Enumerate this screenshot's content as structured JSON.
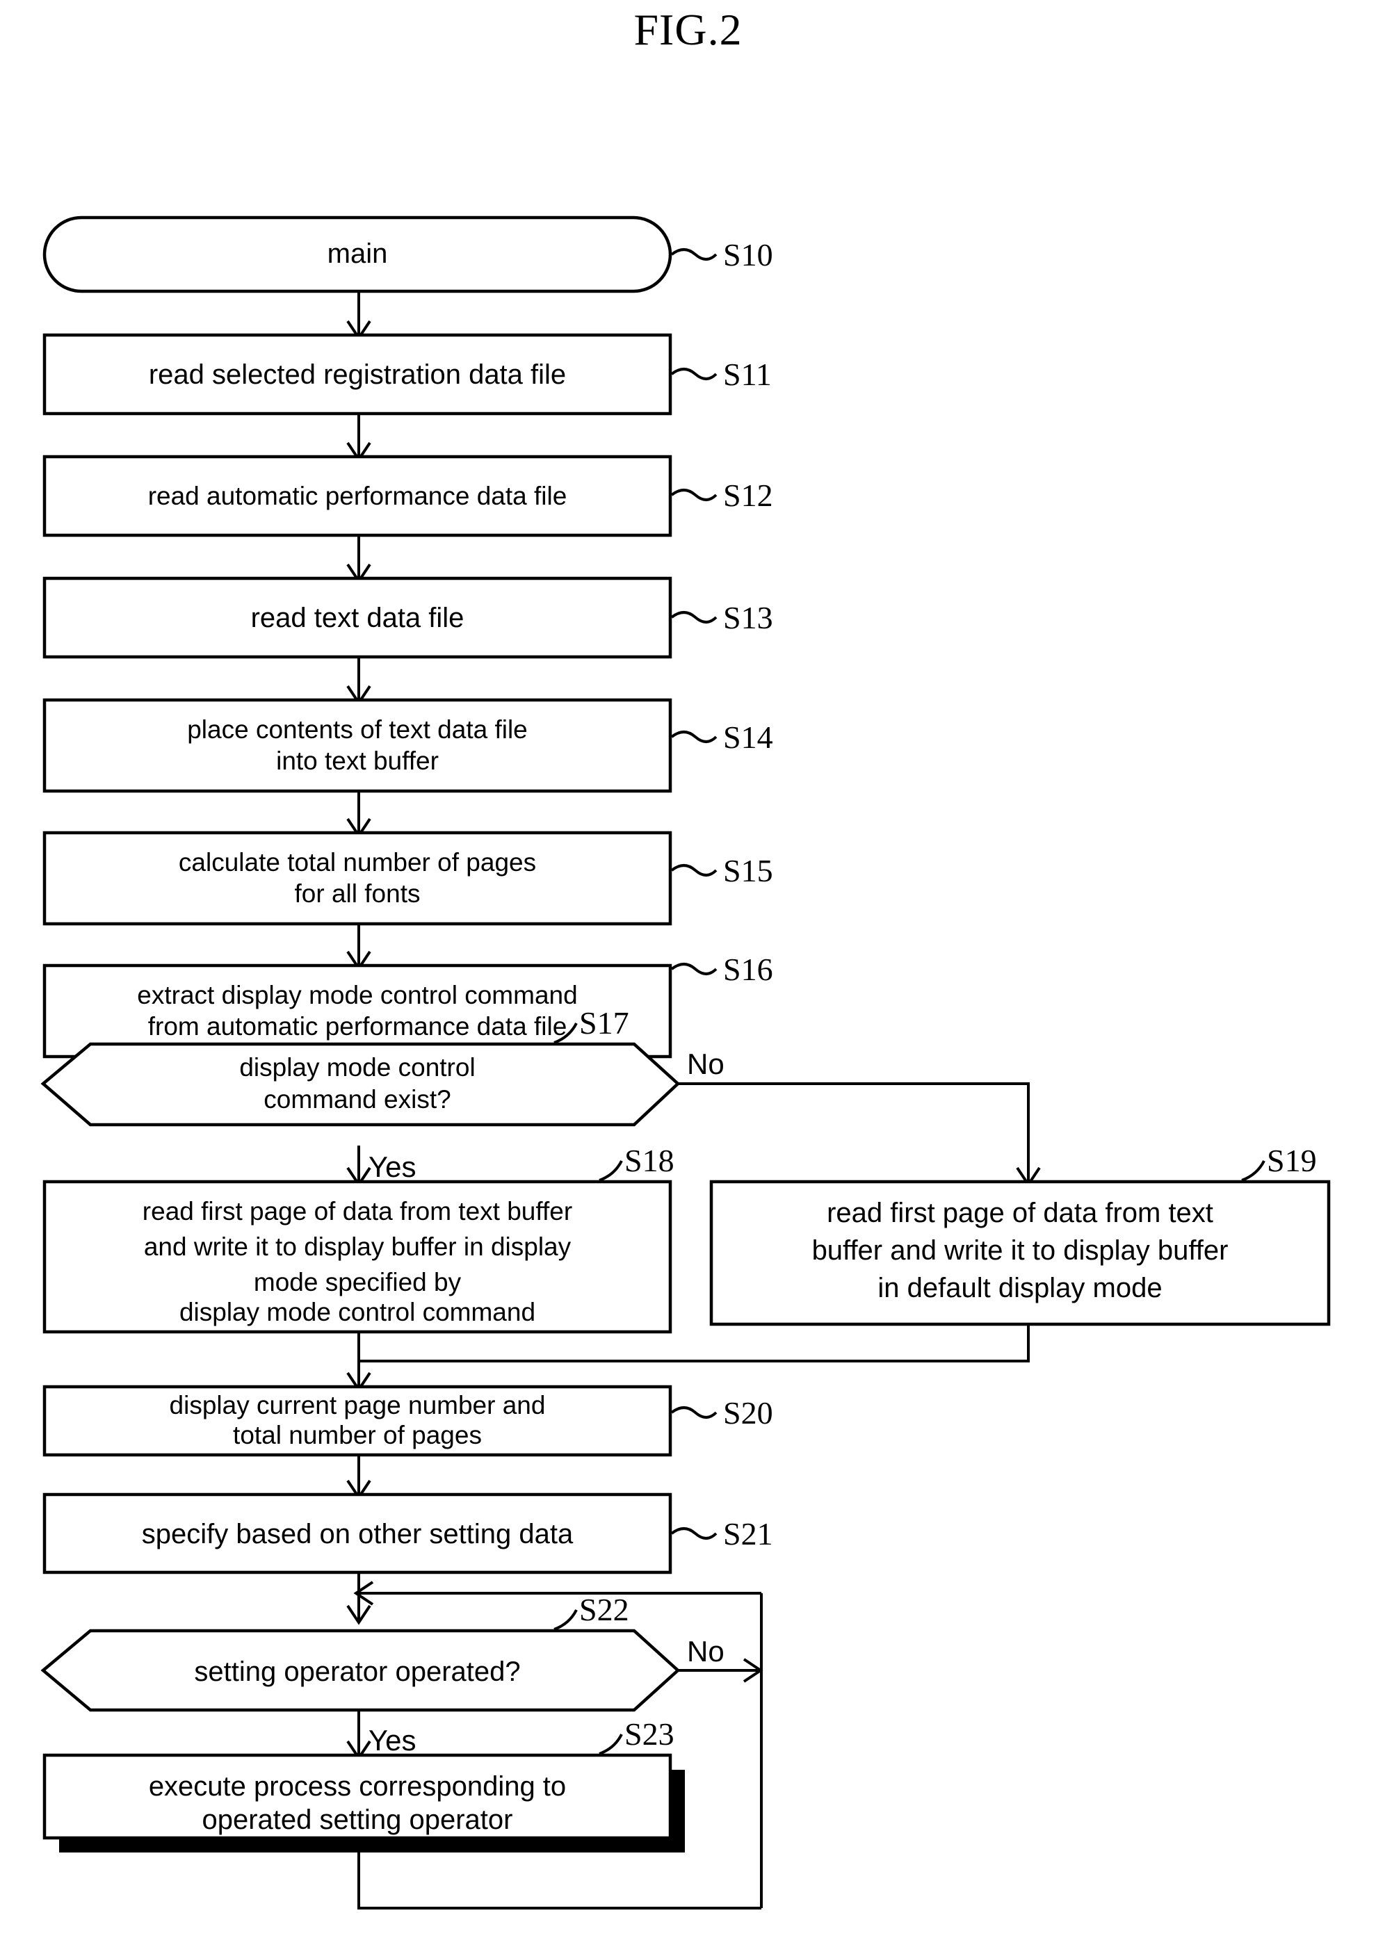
{
  "figure": {
    "title": "FIG.2",
    "type": "flowchart"
  },
  "branch_labels": {
    "yes": "Yes",
    "no": "No"
  },
  "nodes": [
    {
      "id": "S10",
      "label": "S10",
      "shape": "terminator",
      "lines": [
        "main"
      ]
    },
    {
      "id": "S11",
      "label": "S11",
      "shape": "process",
      "lines": [
        "read selected registration data file"
      ]
    },
    {
      "id": "S12",
      "label": "S12",
      "shape": "process",
      "lines": [
        "read automatic performance data file"
      ]
    },
    {
      "id": "S13",
      "label": "S13",
      "shape": "process",
      "lines": [
        "read text data file"
      ]
    },
    {
      "id": "S14",
      "label": "S14",
      "shape": "process",
      "lines": [
        "place contents of text data file",
        "into text buffer"
      ]
    },
    {
      "id": "S15",
      "label": "S15",
      "shape": "process",
      "lines": [
        "calculate total number of pages",
        "for all fonts"
      ]
    },
    {
      "id": "S16",
      "label": "S16",
      "shape": "process",
      "lines": [
        "extract display mode control command",
        "from automatic performance data file"
      ]
    },
    {
      "id": "S17",
      "label": "S17",
      "shape": "decision",
      "lines": [
        "display mode control",
        "command exist?"
      ]
    },
    {
      "id": "S18",
      "label": "S18",
      "shape": "process",
      "lines": [
        "read first page of data from text buffer",
        "and write it to display buffer in display",
        "mode specified by",
        "display mode control command"
      ]
    },
    {
      "id": "S19",
      "label": "S19",
      "shape": "process",
      "lines": [
        "read first page of data from text",
        "buffer and write it to display buffer",
        "in default display mode"
      ]
    },
    {
      "id": "S20",
      "label": "S20",
      "shape": "process",
      "lines": [
        "display current page number and",
        "total number of pages"
      ]
    },
    {
      "id": "S21",
      "label": "S21",
      "shape": "process",
      "lines": [
        "specify based on other setting data"
      ]
    },
    {
      "id": "S22",
      "label": "S22",
      "shape": "decision",
      "lines": [
        "setting operator operated?"
      ]
    },
    {
      "id": "S23",
      "label": "S23",
      "shape": "process-shadow",
      "lines": [
        "execute process corresponding to",
        "operated setting operator"
      ]
    }
  ],
  "edges": [
    {
      "from": "S10",
      "to": "S11",
      "label": ""
    },
    {
      "from": "S11",
      "to": "S12",
      "label": ""
    },
    {
      "from": "S12",
      "to": "S13",
      "label": ""
    },
    {
      "from": "S13",
      "to": "S14",
      "label": ""
    },
    {
      "from": "S14",
      "to": "S15",
      "label": ""
    },
    {
      "from": "S15",
      "to": "S16",
      "label": ""
    },
    {
      "from": "S16",
      "to": "S17",
      "label": ""
    },
    {
      "from": "S17",
      "to": "S18",
      "label": "Yes"
    },
    {
      "from": "S17",
      "to": "S19",
      "label": "No"
    },
    {
      "from": "S18",
      "to": "S20",
      "label": ""
    },
    {
      "from": "S19",
      "to": "S20",
      "label": ""
    },
    {
      "from": "S20",
      "to": "S21",
      "label": ""
    },
    {
      "from": "S21",
      "to": "S22",
      "label": ""
    },
    {
      "from": "S22",
      "to": "S23",
      "label": "Yes"
    },
    {
      "from": "S22",
      "to": "S22",
      "label": "No"
    },
    {
      "from": "S23",
      "to": "S22",
      "label": ""
    }
  ],
  "colors": {
    "stroke": "#000000",
    "fill": "#ffffff",
    "text": "#000000"
  }
}
